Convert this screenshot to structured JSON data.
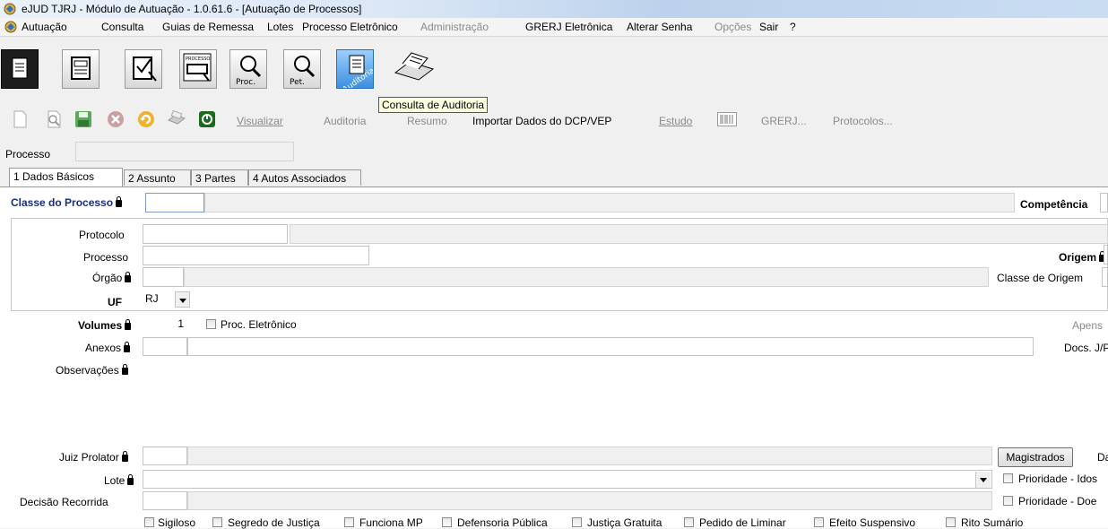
{
  "window": {
    "title": "eJUD TJRJ - Módulo de Autuação - 1.0.61.6 - [Autuação de Processos]"
  },
  "menu": [
    {
      "label": "Autuação",
      "enabled": true
    },
    {
      "label": "Consulta",
      "enabled": true
    },
    {
      "label": "Guias de Remessa",
      "enabled": true
    },
    {
      "label": "Lotes",
      "enabled": true
    },
    {
      "label": "Processo Eletrônico",
      "enabled": true
    },
    {
      "label": "Administração",
      "enabled": false
    },
    {
      "label": "GRERJ Eletrônica",
      "enabled": true
    },
    {
      "label": "Alterar Senha",
      "enabled": true
    },
    {
      "label": "Opções",
      "enabled": false
    },
    {
      "label": "Sair",
      "enabled": true
    },
    {
      "label": "?",
      "enabled": true
    }
  ],
  "big_toolbar": {
    "proc_label": "Proc.",
    "pet_label": "Pet.",
    "processo_label": "PROCESSO",
    "auditoria_label": "Auditoria",
    "tooltip": "Consulta de Auditoria"
  },
  "small_toolbar": {
    "visualizar": "Visualizar",
    "auditoria": "Auditoria",
    "resumo": "Resumo",
    "importar": "Importar Dados do DCP/VEP",
    "estudo": "Estudo",
    "grerj": "GRERJ...",
    "protocolos": "Protocolos..."
  },
  "processo_row": {
    "label": "Processo",
    "value": ""
  },
  "tabs": [
    {
      "label": "1 Dados Básicos",
      "active": true
    },
    {
      "label": "2 Assunto",
      "active": false
    },
    {
      "label": "3 Partes",
      "active": false
    },
    {
      "label": "4 Autos Associados",
      "active": false
    }
  ],
  "form": {
    "classe_do_processo": "Classe do Processo",
    "competencia": "Competência",
    "protocolo": "Protocolo",
    "processo": "Processo",
    "origem": "Origem",
    "orgao": "Órgão",
    "classe_de_origem": "Classe de Origem",
    "uf_label": "UF",
    "uf_value": "RJ",
    "volumes_label": "Volumes",
    "volumes_value": "1",
    "proc_eletronico": "Proc. Eletrônico",
    "apens": "Apens",
    "anexos": "Anexos",
    "docs": "Docs. J/P/",
    "observacoes": "Observações",
    "juiz_prolator": "Juiz Prolator",
    "magistrados_button": "Magistrados",
    "da": "Da",
    "lote": "Lote",
    "prioridade_idoso": "Prioridade - Idos",
    "decisao_recorrida": "Decisão Recorrida",
    "prioridade_doenca": "Prioridade - Doe"
  },
  "checkboxes": [
    {
      "label": "Sigiloso"
    },
    {
      "label": "Segredo de Justiça"
    },
    {
      "label": "Funciona MP"
    },
    {
      "label": "Defensoria Pública"
    },
    {
      "label": "Justiça Gratuita"
    },
    {
      "label": "Pedido de Liminar"
    },
    {
      "label": "Efeito Suspensivo"
    },
    {
      "label": "Rito Sumário"
    }
  ],
  "colors": {
    "label_blue": "#1a2d7d",
    "selected_button": "#3d8fe0",
    "tooltip_bg": "#ffffe1"
  },
  "icons": [
    "app-icon",
    "new-document-icon",
    "open-document-icon",
    "edit-document-icon",
    "processo-icon",
    "search-proc-icon",
    "search-pet-icon",
    "auditoria-icon",
    "scanner-icon",
    "new-file-icon",
    "search-file-icon",
    "save-icon",
    "cancel-icon",
    "undo-icon",
    "print-icon",
    "power-icon",
    "barcode-icon",
    "lock-icon",
    "dropdown-arrow-icon"
  ]
}
